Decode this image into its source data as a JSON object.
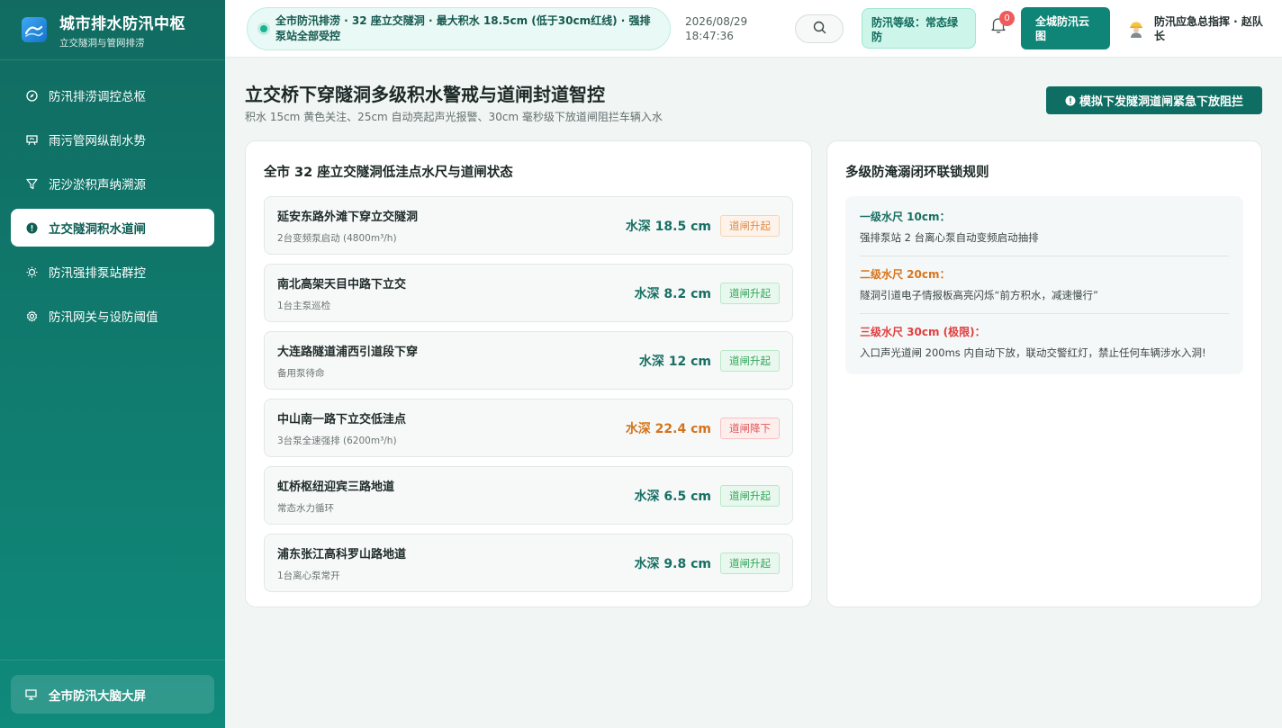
{
  "app": {
    "title": "城市排水防汛中枢",
    "subtitle": "立交隧洞与管网排涝"
  },
  "sidebar": {
    "items": [
      {
        "label": "防汛排涝调控总枢",
        "icon": "compass-icon"
      },
      {
        "label": "雨污管网纵剖水势",
        "icon": "chart-board-icon"
      },
      {
        "label": "泥沙淤积声纳溯源",
        "icon": "funnel-icon"
      },
      {
        "label": "立交隧洞积水道闸",
        "icon": "alert-circle-icon",
        "active": true
      },
      {
        "label": "防汛强排泵站群控",
        "icon": "sun-gear-icon"
      },
      {
        "label": "防汛网关与设防阈值",
        "icon": "settings-icon"
      }
    ],
    "footer_label": "全市防汛大脑大屏"
  },
  "header": {
    "ticker": "全市防汛排涝 · 32 座立交隧洞 · 最大积水 18.5cm (低于30cm红线) · 强排泵站全部受控",
    "date": "2026/08/29",
    "time": "18:47:36",
    "level_badge": "防汛等级：常态绿防",
    "notification_count": "0",
    "cloud_button": "全城防汛云图",
    "user_name": "防汛应急总指挥 · 赵队长"
  },
  "main": {
    "title": "立交桥下穿隧洞多级积水警戒与道闸封道智控",
    "subtitle": "积水 15cm 黄色关注、25cm 自动亮起声光报警、30cm 毫秒级下放道闸阻拦车辆入水",
    "emergency_button": "模拟下发隧洞道闸紧急下放阻拦"
  },
  "tunnels_card": {
    "title": "全市 32 座立交隧洞低洼点水尺与道闸状态",
    "tunnels": [
      {
        "name": "延安东路外滩下穿立交隧洞",
        "pump": "2台变频泵启动 (4800m³/h)",
        "depth": "水深 18.5 cm",
        "gate": "道闸升起",
        "depth_status": "normal",
        "gate_status": "orange"
      },
      {
        "name": "南北高架天目中路下立交",
        "pump": "1台主泵巡检",
        "depth": "水深 8.2 cm",
        "gate": "道闸升起",
        "depth_status": "normal",
        "gate_status": "green"
      },
      {
        "name": "大连路隧道浦西引道段下穿",
        "pump": "备用泵待命",
        "depth": "水深 12 cm",
        "gate": "道闸升起",
        "depth_status": "normal",
        "gate_status": "green"
      },
      {
        "name": "中山南一路下立交低洼点",
        "pump": "3台泵全速强排 (6200m³/h)",
        "depth": "水深 22.4 cm",
        "gate": "道闸降下",
        "depth_status": "warn",
        "gate_status": "red"
      },
      {
        "name": "虹桥枢纽迎宾三路地道",
        "pump": "常态水力循环",
        "depth": "水深 6.5 cm",
        "gate": "道闸升起",
        "depth_status": "normal",
        "gate_status": "green"
      },
      {
        "name": "浦东张江高科罗山路地道",
        "pump": "1台离心泵常开",
        "depth": "水深 9.8 cm",
        "gate": "道闸升起",
        "depth_status": "normal",
        "gate_status": "green"
      }
    ]
  },
  "rules_card": {
    "title": "多级防淹溺闭环联锁规则",
    "rules": [
      {
        "title": "一级水尺 10cm：",
        "desc": "强排泵站 2 台离心泵自动变频启动抽排",
        "color": "green"
      },
      {
        "title": "二级水尺 20cm：",
        "desc": "隧洞引道电子情报板高亮闪烁“前方积水，减速慢行”",
        "color": "orange"
      },
      {
        "title": "三级水尺 30cm (极限)：",
        "desc": "入口声光道闸 200ms 内自动下放，联动交警红灯，禁止任何车辆涉水入洞!",
        "color": "red"
      }
    ]
  },
  "colors": {
    "sidebar": "#116b61",
    "accent": "#0f8577",
    "warn": "#d4731b",
    "danger": "#e03e3e"
  }
}
